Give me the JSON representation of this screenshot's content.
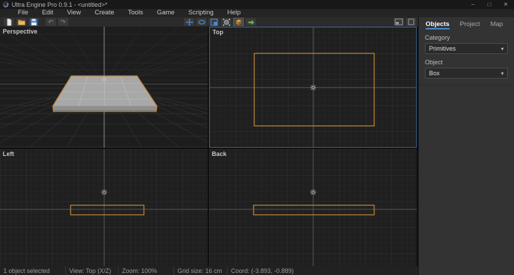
{
  "window": {
    "title": "Ultra Engine Pro 0.9.1 - <untitled>*",
    "minimize": "–",
    "maximize": "□",
    "close": "✕"
  },
  "menu": {
    "items": [
      "File",
      "Edit",
      "View",
      "Create",
      "Tools",
      "Game",
      "Scripting",
      "Help"
    ]
  },
  "toolbar": {
    "undo_glyph": "↶",
    "redo_glyph": "↷",
    "icons": [
      "new-file",
      "open-folder",
      "save",
      "undo",
      "redo",
      "move-tool",
      "rotate-tool",
      "scale-tool",
      "sphere-select",
      "create-box",
      "run-game",
      "split-viewport",
      "single-viewport"
    ]
  },
  "viewports": {
    "perspective": "Perspective",
    "top": "Top",
    "left": "Left",
    "back": "Back"
  },
  "panel": {
    "tabs": {
      "objects": "Objects",
      "project": "Project",
      "map": "Map"
    },
    "active_tab": "Objects",
    "category_label": "Category",
    "category_value": "Primitives",
    "object_label": "Object",
    "object_value": "Box",
    "dropdown_caret": "▾"
  },
  "status": {
    "selected": "1 object selected",
    "view": "View: Top (X/Z)",
    "zoom": "Zoom: 100%",
    "grid": "Grid size: 16 cm",
    "coord": "Coord: (-3.893, -0.889)"
  },
  "colors": {
    "selection_orange": "#c08538",
    "active_viewport_blue": "#3e6190",
    "tab_underline_blue": "#4a8fd4",
    "tool_icon_blue": "#4b87cf",
    "run_green": "#6fae4e"
  }
}
